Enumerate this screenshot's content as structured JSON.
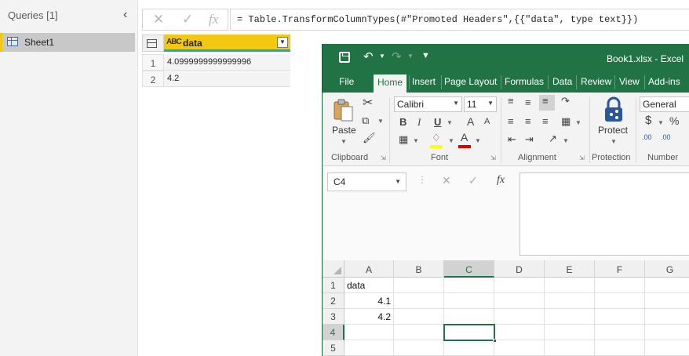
{
  "power_query": {
    "queries_header": "Queries [1]",
    "collapse_icon": "chevron-left-icon",
    "query_item": "Sheet1",
    "formula_buttons": {
      "cancel": "✕",
      "commit": "✓",
      "fx": "fx"
    },
    "formula": "= Table.TransformColumnTypes(#\"Promoted Headers\",{{\"data\", type text}})",
    "column_type": "ABC",
    "column_header": "data",
    "rows": [
      {
        "num": "1",
        "value": "4.0999999999999996"
      },
      {
        "num": "2",
        "value": "4.2"
      }
    ],
    "accent_color": "#f2c811"
  },
  "excel": {
    "title": "Book1.xlsx - Excel",
    "qat": {
      "undo": "↶",
      "redo": "↷"
    },
    "tabs": [
      "File",
      "Home",
      "Insert",
      "Page Layout",
      "Formulas",
      "Data",
      "Review",
      "View",
      "Add-ins"
    ],
    "active_tab": "Home",
    "ribbon": {
      "clipboard": {
        "paste_label": "Paste",
        "group_label": "Clipboard"
      },
      "font": {
        "font_name": "Calibri",
        "font_size": "11",
        "bold": "B",
        "italic": "I",
        "underline": "U",
        "grow": "A",
        "shrink": "A",
        "font_color": "A",
        "group_label": "Font"
      },
      "alignment": {
        "group_label": "Alignment"
      },
      "protection": {
        "protect_label": "Protect",
        "group_label": "Protection"
      },
      "number": {
        "format": "General",
        "currency": "$",
        "percent": "%",
        "inc_decimal": ".00",
        "dec_decimal": ".00",
        "group_label": "Number"
      }
    },
    "name_box": "C4",
    "formula_fx": "fx",
    "columns": [
      "A",
      "B",
      "C",
      "D",
      "E",
      "F",
      "G"
    ],
    "selected_column": "C",
    "rows": [
      "1",
      "2",
      "3",
      "4",
      "5"
    ],
    "selected_row": "4",
    "cells": {
      "A1": "data",
      "A2": "4.1",
      "A3": "4.2"
    },
    "brand_color": "#217346"
  }
}
